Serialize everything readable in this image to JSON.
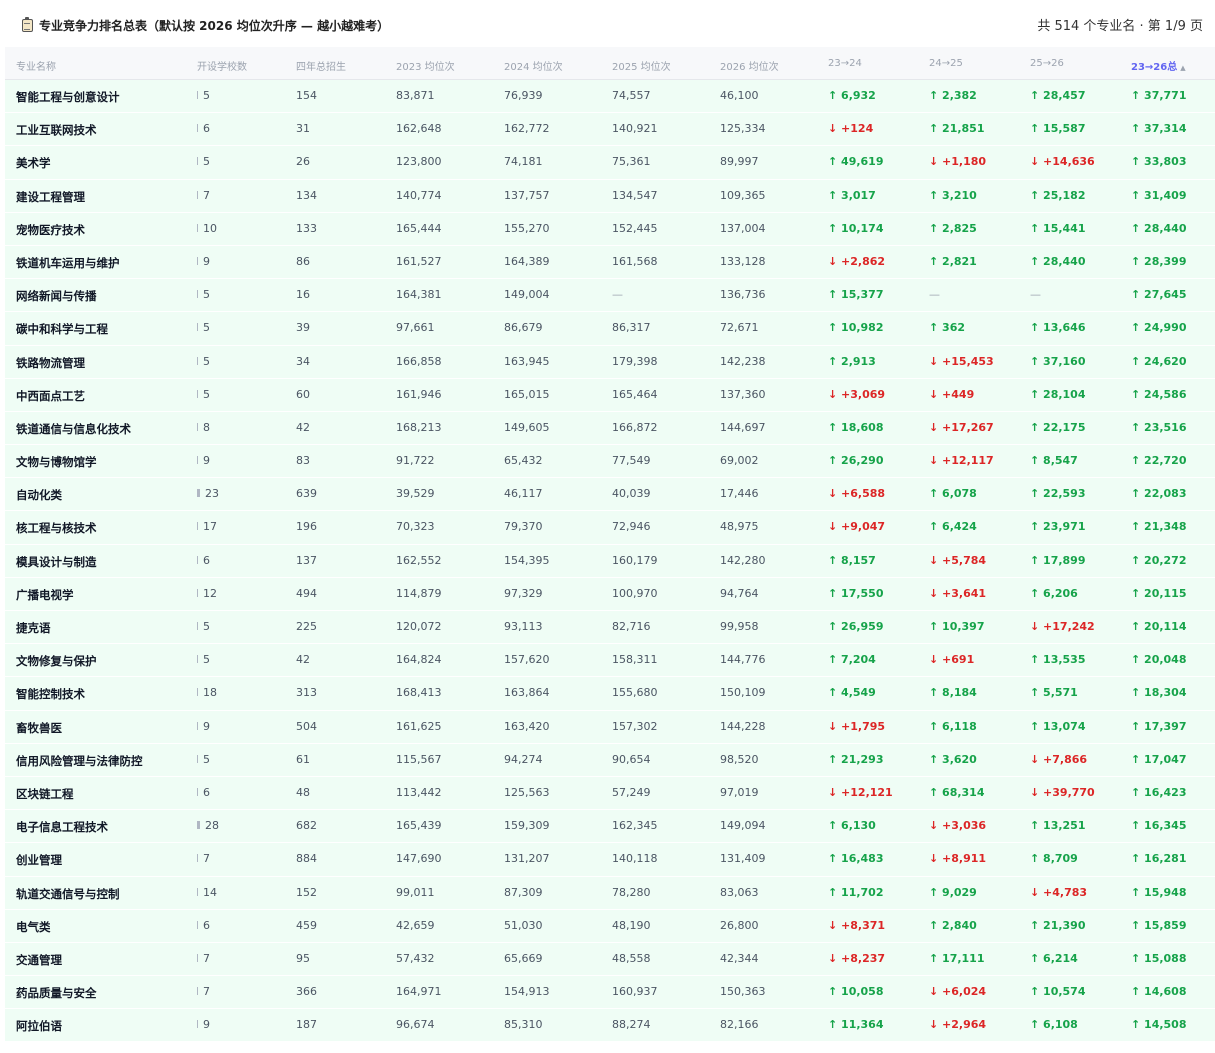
{
  "header": {
    "title": "专业竞争力排名总表（默认按 2026 均位次升序 — 越小越难考）",
    "summary": "共 514 个专业名 · 第 1/9 页"
  },
  "columns": [
    "专业名称",
    "开设学校数",
    "四年总招生",
    "2023 均位次",
    "2024 均位次",
    "2025 均位次",
    "2026 均位次",
    "23→24",
    "24→25",
    "25→26",
    "23→26总"
  ],
  "sorted_column_index": 10,
  "rows": [
    [
      "智能工程与创意设计",
      "5",
      "154",
      "83,871",
      "76,939",
      "74,557",
      "46,100",
      "↑ 6,932",
      "↑ 2,382",
      "↑ 28,457",
      "↑ 37,771"
    ],
    [
      "工业互联网技术",
      "6",
      "31",
      "162,648",
      "162,772",
      "140,921",
      "125,334",
      "↓ +124",
      "↑ 21,851",
      "↑ 15,587",
      "↑ 37,314"
    ],
    [
      "美术学",
      "5",
      "26",
      "123,800",
      "74,181",
      "75,361",
      "89,997",
      "↑ 49,619",
      "↓ +1,180",
      "↓ +14,636",
      "↑ 33,803"
    ],
    [
      "建设工程管理",
      "7",
      "134",
      "140,774",
      "137,757",
      "134,547",
      "109,365",
      "↑ 3,017",
      "↑ 3,210",
      "↑ 25,182",
      "↑ 31,409"
    ],
    [
      "宠物医疗技术",
      "10",
      "133",
      "165,444",
      "155,270",
      "152,445",
      "137,004",
      "↑ 10,174",
      "↑ 2,825",
      "↑ 15,441",
      "↑ 28,440"
    ],
    [
      "铁道机车运用与维护",
      "9",
      "86",
      "161,527",
      "164,389",
      "161,568",
      "133,128",
      "↓ +2,862",
      "↑ 2,821",
      "↑ 28,440",
      "↑ 28,399"
    ],
    [
      "网络新闻与传播",
      "5",
      "16",
      "164,381",
      "149,004",
      "—",
      "136,736",
      "↑ 15,377",
      "—",
      "—",
      "↑ 27,645"
    ],
    [
      "碳中和科学与工程",
      "5",
      "39",
      "97,661",
      "86,679",
      "86,317",
      "72,671",
      "↑ 10,982",
      "↑ 362",
      "↑ 13,646",
      "↑ 24,990"
    ],
    [
      "铁路物流管理",
      "5",
      "34",
      "166,858",
      "163,945",
      "179,398",
      "142,238",
      "↑ 2,913",
      "↓ +15,453",
      "↑ 37,160",
      "↑ 24,620"
    ],
    [
      "中西面点工艺",
      "5",
      "60",
      "161,946",
      "165,015",
      "165,464",
      "137,360",
      "↓ +3,069",
      "↓ +449",
      "↑ 28,104",
      "↑ 24,586"
    ],
    [
      "铁道通信与信息化技术",
      "8",
      "42",
      "168,213",
      "149,605",
      "166,872",
      "144,697",
      "↑ 18,608",
      "↓ +17,267",
      "↑ 22,175",
      "↑ 23,516"
    ],
    [
      "文物与博物馆学",
      "9",
      "83",
      "91,722",
      "65,432",
      "77,549",
      "69,002",
      "↑ 26,290",
      "↓ +12,117",
      "↑ 8,547",
      "↑ 22,720"
    ],
    [
      "自动化类",
      "23",
      "639",
      "39,529",
      "46,117",
      "40,039",
      "17,446",
      "↓ +6,588",
      "↑ 6,078",
      "↑ 22,593",
      "↑ 22,083"
    ],
    [
      "核工程与核技术",
      "17",
      "196",
      "70,323",
      "79,370",
      "72,946",
      "48,975",
      "↓ +9,047",
      "↑ 6,424",
      "↑ 23,971",
      "↑ 21,348"
    ],
    [
      "模具设计与制造",
      "6",
      "137",
      "162,552",
      "154,395",
      "160,179",
      "142,280",
      "↑ 8,157",
      "↓ +5,784",
      "↑ 17,899",
      "↑ 20,272"
    ],
    [
      "广播电视学",
      "12",
      "494",
      "114,879",
      "97,329",
      "100,970",
      "94,764",
      "↑ 17,550",
      "↓ +3,641",
      "↑ 6,206",
      "↑ 20,115"
    ],
    [
      "捷克语",
      "5",
      "225",
      "120,072",
      "93,113",
      "82,716",
      "99,958",
      "↑ 26,959",
      "↑ 10,397",
      "↓ +17,242",
      "↑ 20,114"
    ],
    [
      "文物修复与保护",
      "5",
      "42",
      "164,824",
      "157,620",
      "158,311",
      "144,776",
      "↑ 7,204",
      "↓ +691",
      "↑ 13,535",
      "↑ 20,048"
    ],
    [
      "智能控制技术",
      "18",
      "313",
      "168,413",
      "163,864",
      "155,680",
      "150,109",
      "↑ 4,549",
      "↑ 8,184",
      "↑ 5,571",
      "↑ 18,304"
    ],
    [
      "畜牧兽医",
      "9",
      "504",
      "161,625",
      "163,420",
      "157,302",
      "144,228",
      "↓ +1,795",
      "↑ 6,118",
      "↑ 13,074",
      "↑ 17,397"
    ],
    [
      "信用风险管理与法律防控",
      "5",
      "61",
      "115,567",
      "94,274",
      "90,654",
      "98,520",
      "↑ 21,293",
      "↑ 3,620",
      "↓ +7,866",
      "↑ 17,047"
    ],
    [
      "区块链工程",
      "6",
      "48",
      "113,442",
      "125,563",
      "57,249",
      "97,019",
      "↓ +12,121",
      "↑ 68,314",
      "↓ +39,770",
      "↑ 16,423"
    ],
    [
      "电子信息工程技术",
      "28",
      "682",
      "165,439",
      "159,309",
      "162,345",
      "149,094",
      "↑ 6,130",
      "↓ +3,036",
      "↑ 13,251",
      "↑ 16,345"
    ],
    [
      "创业管理",
      "7",
      "884",
      "147,690",
      "131,207",
      "140,118",
      "131,409",
      "↑ 16,483",
      "↓ +8,911",
      "↑ 8,709",
      "↑ 16,281"
    ],
    [
      "轨道交通信号与控制",
      "14",
      "152",
      "99,011",
      "87,309",
      "78,280",
      "83,063",
      "↑ 11,702",
      "↑ 9,029",
      "↓ +4,783",
      "↑ 15,948"
    ],
    [
      "电气类",
      "6",
      "459",
      "42,659",
      "51,030",
      "48,190",
      "26,800",
      "↓ +8,371",
      "↑ 2,840",
      "↑ 21,390",
      "↑ 15,859"
    ],
    [
      "交通管理",
      "7",
      "95",
      "57,432",
      "65,669",
      "48,558",
      "42,344",
      "↓ +8,237",
      "↑ 17,111",
      "↑ 6,214",
      "↑ 15,088"
    ],
    [
      "药品质量与安全",
      "7",
      "366",
      "164,971",
      "154,913",
      "160,937",
      "150,363",
      "↑ 10,058",
      "↓ +6,024",
      "↑ 10,574",
      "↑ 14,608"
    ],
    [
      "阿拉伯语",
      "9",
      "187",
      "96,674",
      "85,310",
      "88,274",
      "82,166",
      "↑ 11,364",
      "↓ +2,964",
      "↑ 6,108",
      "↑ 14,508"
    ]
  ]
}
